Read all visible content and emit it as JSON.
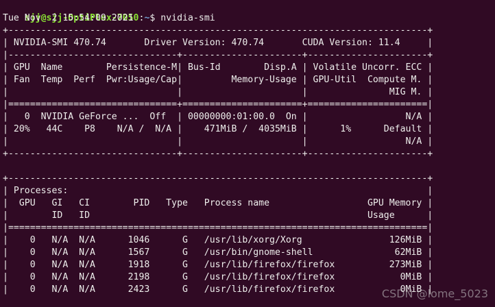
{
  "prompt": {
    "user_host": "sjj@sjj-OptiPlex-7050",
    "separator": ":",
    "path": "~",
    "symbol": "$ ",
    "command": "nvidia-smi"
  },
  "output_lines": [
    "Tue Nov  2 15:54:09 2021",
    "+-----------------------------------------------------------------------------+",
    "| NVIDIA-SMI 470.74       Driver Version: 470.74       CUDA Version: 11.4     |",
    "|-------------------------------+----------------------+----------------------+",
    "| GPU  Name        Persistence-M| Bus-Id        Disp.A | Volatile Uncorr. ECC |",
    "| Fan  Temp  Perf  Pwr:Usage/Cap|         Memory-Usage | GPU-Util  Compute M. |",
    "|                               |                      |               MIG M. |",
    "|===============================+======================+======================|",
    "|   0  NVIDIA GeForce ...  Off  | 00000000:01:00.0  On |                  N/A |",
    "| 20%   44C    P8    N/A /  N/A |    471MiB /  4035MiB |      1%      Default |",
    "|                               |                      |                  N/A |",
    "+-------------------------------+----------------------+----------------------+",
    "",
    "+-----------------------------------------------------------------------------+",
    "| Processes:                                                                  |",
    "|  GPU   GI   CI        PID   Type   Process name                  GPU Memory |",
    "|        ID   ID                                                   Usage      |",
    "|=============================================================================|",
    "|    0   N/A  N/A      1046      G   /usr/lib/xorg/Xorg                126MiB |",
    "|    0   N/A  N/A      1567      G   /usr/bin/gnome-shell               62MiB |",
    "|    0   N/A  N/A      1918      G   /usr/lib/firefox/firefox          273MiB |",
    "|    0   N/A  N/A      2198      G   /usr/lib/firefox/firefox            0MiB |",
    "|    0   N/A  N/A      2423      G   /usr/lib/firefox/firefox            0MiB |"
  ],
  "watermark": "CSDN @lome_5023",
  "colors": {
    "background": "#300a24",
    "text": "#eeeeec",
    "prompt_user": "#8ae234",
    "prompt_path": "#729fcf"
  }
}
